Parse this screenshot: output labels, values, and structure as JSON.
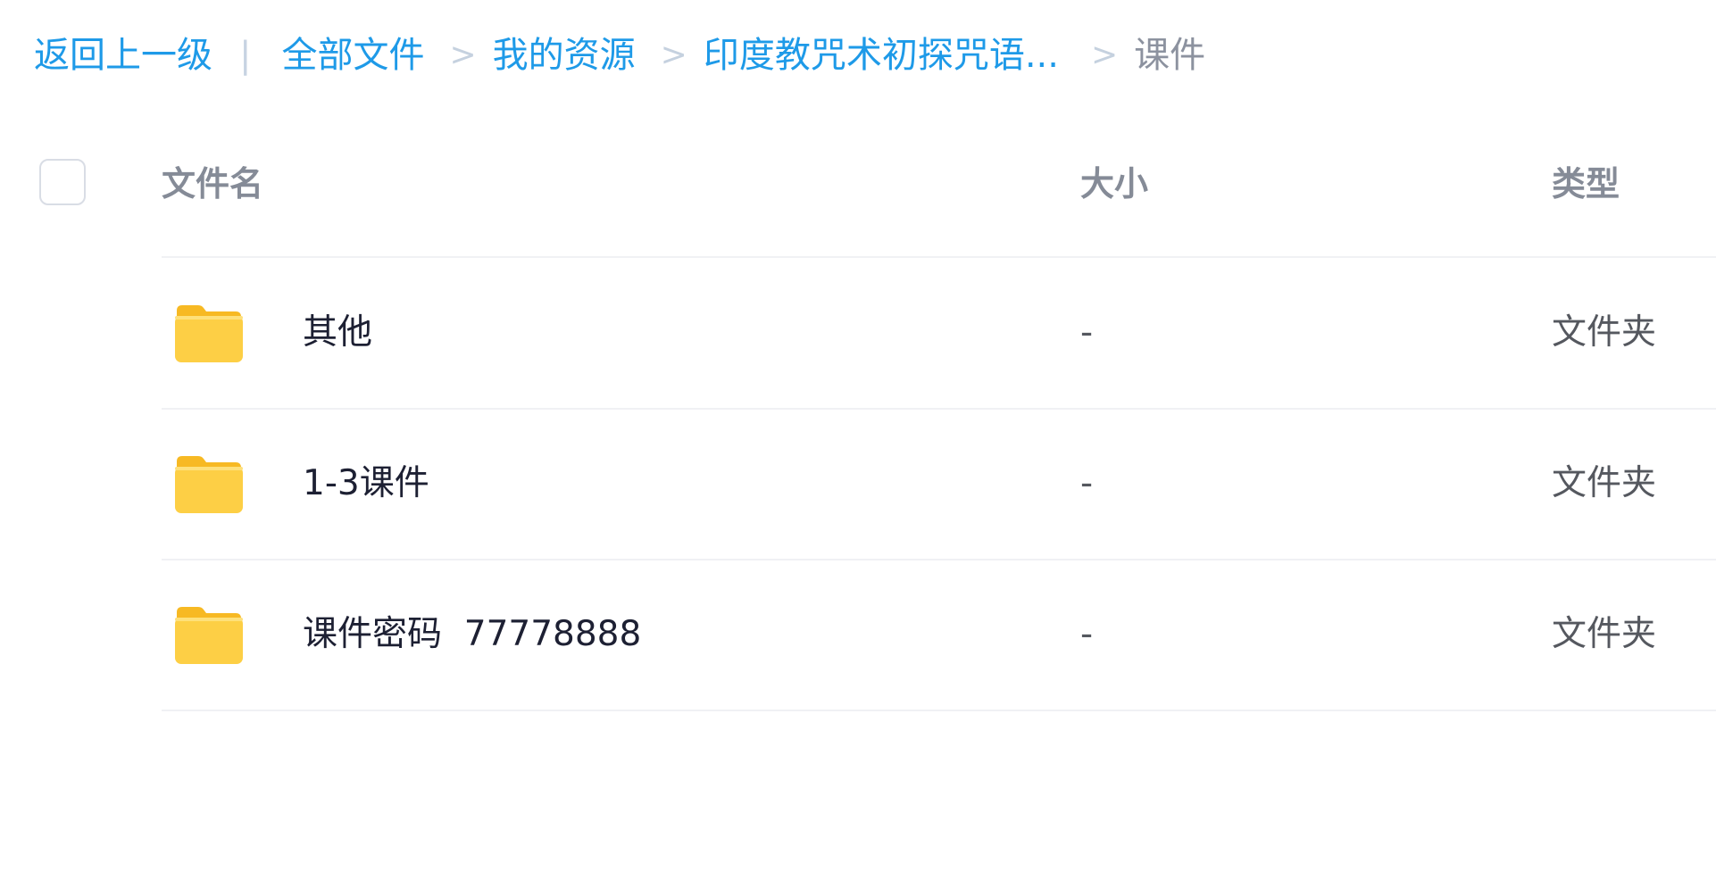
{
  "breadcrumb": {
    "back_label": "返回上一级",
    "divider": "|",
    "items": [
      {
        "label": "全部文件"
      },
      {
        "label": "我的资源"
      },
      {
        "label": "印度教咒术初探咒语..."
      }
    ],
    "separator": ">",
    "current": "课件"
  },
  "table": {
    "columns": {
      "name": "文件名",
      "size": "大小",
      "type": "类型"
    },
    "rows": [
      {
        "icon": "folder-icon",
        "name": "其他",
        "size": "-",
        "type": "文件夹"
      },
      {
        "icon": "folder-icon",
        "name": "1-3课件",
        "size": "-",
        "type": "文件夹"
      },
      {
        "icon": "folder-icon",
        "name": "课件密码  77778888",
        "size": "-",
        "type": "文件夹"
      }
    ]
  },
  "colors": {
    "link": "#1e9ae8",
    "folder": "#fcc93a",
    "divider": "#f0f1f4"
  }
}
